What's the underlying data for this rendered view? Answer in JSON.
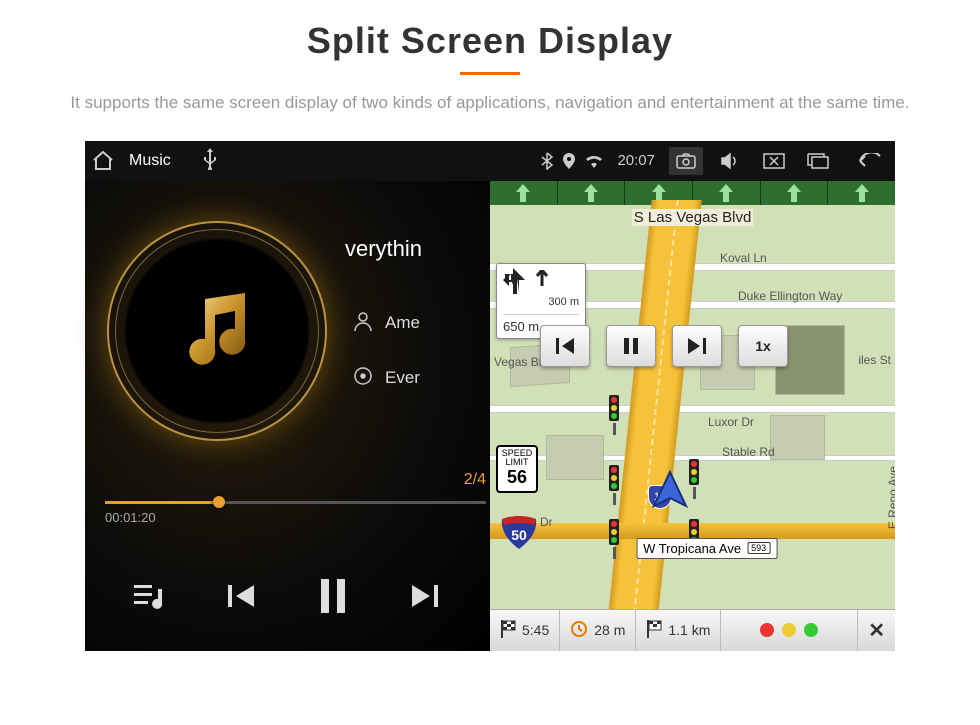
{
  "page": {
    "title": "Split Screen Display",
    "description": "It supports the same screen display of two kinds of applications, navigation and entertainment at the same time."
  },
  "statusbar": {
    "app_title": "Music",
    "time": "20:07"
  },
  "music": {
    "track_title": "verythin",
    "artist": "Ame",
    "album": "Ever",
    "index": "2/4",
    "elapsed": "00:01:20",
    "progress_pct": 30
  },
  "nav": {
    "top_street": "S Las Vegas Blvd",
    "turn_distance_primary": "300 m",
    "turn_distance_secondary": "650 m",
    "speed_button": "1x",
    "speed_limit_label": "SPEED LIMIT",
    "speed_limit_value": "56",
    "interstate_number": "50",
    "route_shield": "15",
    "current_road": "W Tropicana Ave",
    "current_road_badge": "593",
    "labels": {
      "koval": "Koval Ln",
      "duke": "Duke Ellington Way",
      "vegas": "Vegas Blvd",
      "ali": "iles St",
      "luxor": "Luxor Dr",
      "stable": "Stable Rd",
      "reno": "E Reno Ave",
      "martin": "rtin Dr"
    },
    "footer": {
      "eta": "5:45",
      "remaining": "28 m",
      "distance": "1.1 km",
      "close": "✕"
    }
  }
}
